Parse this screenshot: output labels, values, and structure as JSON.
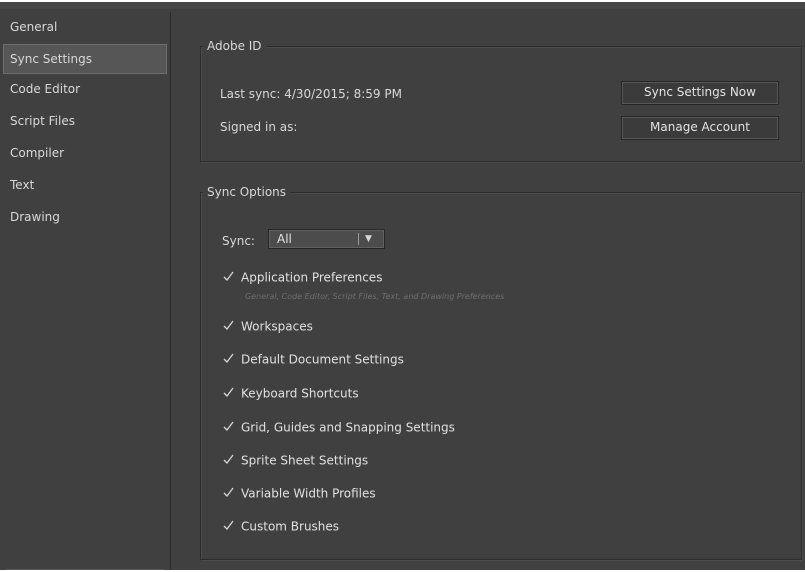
{
  "sidebar": {
    "items": [
      {
        "label": "General"
      },
      {
        "label": "Sync Settings"
      },
      {
        "label": "Code Editor"
      },
      {
        "label": "Script Files"
      },
      {
        "label": "Compiler"
      },
      {
        "label": "Text"
      },
      {
        "label": "Drawing"
      }
    ],
    "selected": "Sync Settings"
  },
  "adobe_id": {
    "title": "Adobe ID",
    "last_sync": "Last sync: 4/30/2015; 8:59 PM",
    "signed_in": "Signed in as:",
    "sync_now_button": "Sync Settings Now",
    "manage_account_button": "Manage Account"
  },
  "sync_options": {
    "title": "Sync Options",
    "sync_label": "Sync:",
    "sync_value": "All",
    "options": [
      {
        "label": "Application Preferences",
        "checked": true
      },
      {
        "label": "Workspaces",
        "checked": true
      },
      {
        "label": "Default Document Settings",
        "checked": true
      },
      {
        "label": "Keyboard Shortcuts",
        "checked": true
      },
      {
        "label": "Grid, Guides and Snapping Settings",
        "checked": true
      },
      {
        "label": "Sprite Sheet Settings",
        "checked": true
      },
      {
        "label": "Variable Width Profiles",
        "checked": true
      },
      {
        "label": "Custom Brushes",
        "checked": true
      }
    ],
    "app_prefs_subtitle": "General, Code Editor, Script Files, Text, and Drawing Preferences"
  },
  "icons": {
    "checkbox": "checkmark-icon",
    "dropdown": "chevron-down-icon"
  }
}
